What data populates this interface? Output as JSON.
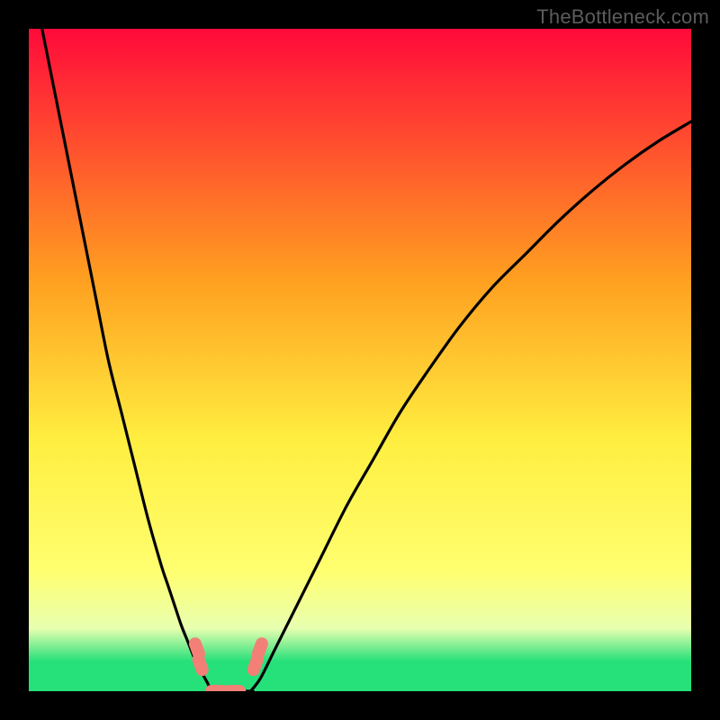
{
  "watermark": "TheBottleneck.com",
  "colors": {
    "topRed": "#ff0a3a",
    "midOrange": "#ffa020",
    "midYellow": "#ffee40",
    "lowYellow": "#ffff70",
    "paleGreen": "#e8ffb0",
    "green": "#26e07a",
    "curve": "#000000",
    "marker": "#f28076",
    "background": "#000000"
  },
  "chart_data": {
    "type": "line",
    "title": "",
    "xlabel": "",
    "ylabel": "",
    "x_range": [
      0,
      100
    ],
    "y_range": [
      0,
      100
    ],
    "note": "Deviation-style curve. Rendered on red→green vertical gradient (top=worst, bottom=best). No visible axis ticks or gridlines.",
    "series": [
      {
        "name": "left-branch",
        "x": [
          0,
          2,
          4,
          6,
          8,
          10,
          12,
          14,
          16,
          18,
          20,
          21,
          22,
          23,
          24,
          25,
          26,
          27,
          27.5
        ],
        "y": [
          110,
          100,
          90,
          80,
          70,
          60,
          50,
          42,
          34,
          26,
          19,
          16,
          13,
          10,
          7.5,
          5,
          3,
          1.2,
          0
        ]
      },
      {
        "name": "floor",
        "x": [
          27.5,
          33.5
        ],
        "y": [
          0,
          0
        ]
      },
      {
        "name": "right-branch",
        "x": [
          33.5,
          35,
          37,
          40,
          44,
          48,
          52,
          56,
          60,
          65,
          70,
          75,
          80,
          85,
          90,
          95,
          100
        ],
        "y": [
          0,
          2,
          6,
          12,
          20,
          28,
          35,
          42,
          48,
          55,
          61,
          66,
          71,
          75.5,
          79.5,
          83,
          86
        ]
      }
    ],
    "markers": [
      {
        "name": "left-pair",
        "x": 25.4,
        "y": 6.4
      },
      {
        "name": "left-pair",
        "x": 25.9,
        "y": 4.0
      },
      {
        "name": "floor-a",
        "x": 28.4,
        "y": 0.0
      },
      {
        "name": "floor-b",
        "x": 31.0,
        "y": 0.0
      },
      {
        "name": "right-pair",
        "x": 34.2,
        "y": 4.0
      },
      {
        "name": "right-pair",
        "x": 34.9,
        "y": 6.4
      }
    ],
    "gradient_stops": [
      {
        "offset": 0.0,
        "key": "topRed"
      },
      {
        "offset": 0.38,
        "key": "midOrange"
      },
      {
        "offset": 0.62,
        "key": "midYellow"
      },
      {
        "offset": 0.82,
        "key": "lowYellow"
      },
      {
        "offset": 0.905,
        "key": "paleGreen"
      },
      {
        "offset": 0.955,
        "key": "green"
      },
      {
        "offset": 1.0,
        "key": "green"
      }
    ]
  }
}
